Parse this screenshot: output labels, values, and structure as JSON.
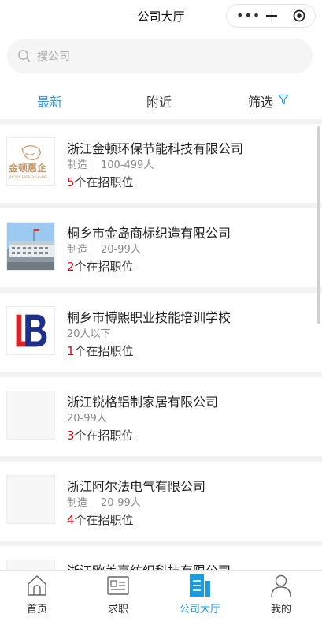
{
  "app": {
    "title": "公司大厅"
  },
  "capsule": {
    "more_icon": "more-dots-icon",
    "minimize_icon": "minimize-icon",
    "close_icon": "record-close-icon"
  },
  "search": {
    "placeholder": "搜公司",
    "value": ""
  },
  "tabs": [
    {
      "label": "最新",
      "active": true
    },
    {
      "label": "附近",
      "active": false
    },
    {
      "label": "筛选",
      "active": false,
      "icon": "filter-icon"
    }
  ],
  "companies": [
    {
      "name": "浙江金顿环保节能科技有限公司",
      "industry": "制造",
      "size": "100-499人",
      "job_count": "5",
      "job_suffix": "个在招职位",
      "logo": "jindun-logo",
      "logo_text": "金顿惠企",
      "logo_subtext": "JINDUN ENERGY SAVING"
    },
    {
      "name": "桐乡市金岛商标织造有限公司",
      "industry": "制造",
      "size": "20-99人",
      "job_count": "2",
      "job_suffix": "个在招职位",
      "logo": "factory-photo"
    },
    {
      "name": "桐乡市博熙职业技能培训学校",
      "industry": "",
      "size": "20人以下",
      "job_count": "1",
      "job_suffix": "个在招职位",
      "logo": "lb-logo"
    },
    {
      "name": "浙江锐格铝制家居有限公司",
      "industry": "",
      "size": "20-99人",
      "job_count": "3",
      "job_suffix": "个在招职位",
      "logo": "blank"
    },
    {
      "name": "浙江阿尔法电气有限公司",
      "industry": "制造",
      "size": "20-99人",
      "job_count": "4",
      "job_suffix": "个在招职位",
      "logo": "blank"
    },
    {
      "name": "浙江欧美嘉纺织科技有限公司",
      "industry": "",
      "size": "",
      "job_count": "",
      "job_suffix": "",
      "logo": "blank"
    }
  ],
  "tabbar": [
    {
      "label": "首页",
      "icon": "home-icon",
      "active": false
    },
    {
      "label": "求职",
      "icon": "resume-card-icon",
      "active": false
    },
    {
      "label": "公司大厅",
      "icon": "building-icon",
      "active": true
    },
    {
      "label": "我的",
      "icon": "user-icon",
      "active": false
    }
  ],
  "colors": {
    "accent": "#2d9cdb",
    "tabbar_active": "#1a9be0",
    "job_count": "#e60012"
  }
}
